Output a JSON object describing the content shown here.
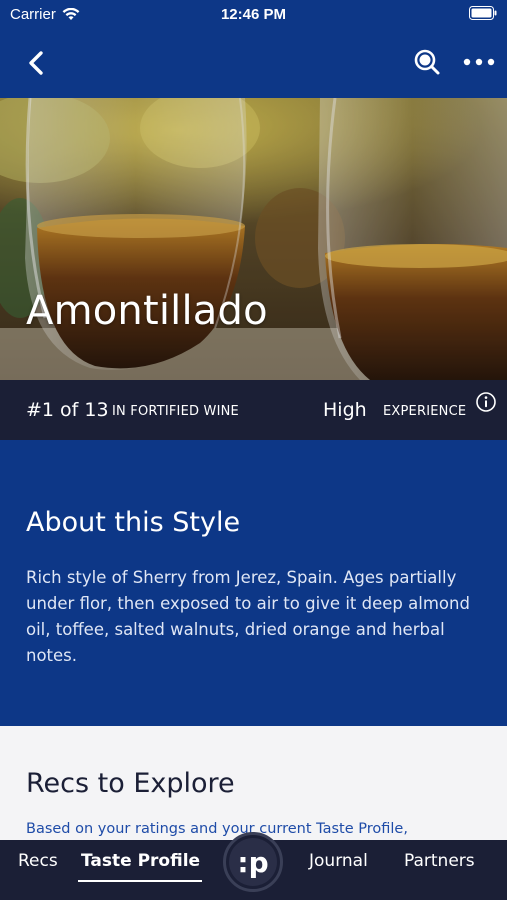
{
  "status_bar": {
    "carrier": "Carrier",
    "time": "12:46 PM"
  },
  "nav": {
    "back_icon": "chevron-left-icon",
    "search_icon": "search-icon",
    "more_icon": "more-horizontal-icon"
  },
  "hero": {
    "title": "Amontillado"
  },
  "rank": {
    "position": "#1 of 13",
    "category": "IN FORTIFIED WINE",
    "level": "High",
    "level_category": "EXPERIENCE",
    "info_icon": "info-icon"
  },
  "about": {
    "heading": "About this Style",
    "body": "Rich style of Sherry from Jerez, Spain. Ages partially under flor, then exposed to air to give it deep almond oil, toffee, salted walnuts, dried orange and herbal notes."
  },
  "recs": {
    "heading": "Recs to Explore",
    "subtitle": "Based on your ratings and your current Taste Profile,"
  },
  "tab_bar": {
    "recs": "Recs",
    "taste_profile": "Taste Profile",
    "logo": ":p",
    "journal": "Journal",
    "partners": "Partners",
    "active": "Taste Profile"
  },
  "colors": {
    "primary_blue": "#0d3787",
    "dark_navy": "#1b1f36",
    "light_bg": "#f4f4f6",
    "link_blue": "#1f4ca8"
  }
}
